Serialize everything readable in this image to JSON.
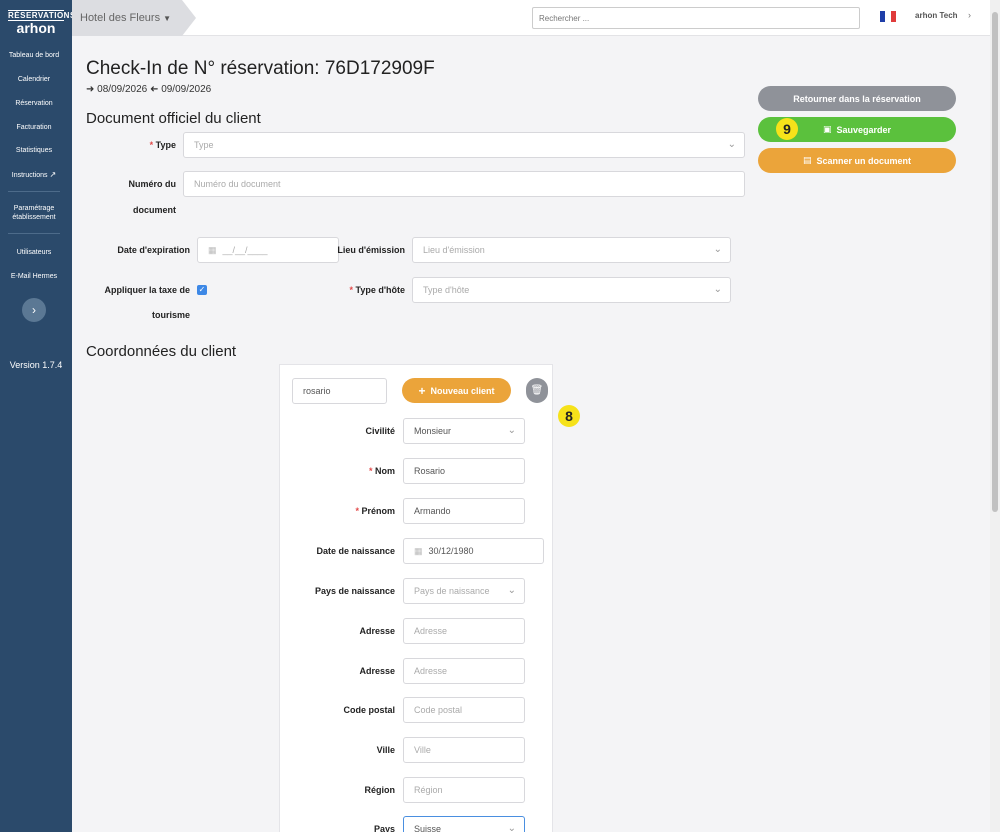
{
  "sidebar": {
    "logo_top": "RÉSERVATIONS",
    "logo_main": "arhon",
    "items": [
      {
        "label": "Tableau de bord"
      },
      {
        "label": "Calendrier"
      },
      {
        "label": "Réservation"
      },
      {
        "label": "Facturation"
      },
      {
        "label": "Statistiques"
      },
      {
        "label": "Instructions"
      },
      {
        "label": "Paramétrage établissement"
      },
      {
        "label": "Utilisateurs"
      },
      {
        "label": "E-Mail Hermes"
      }
    ],
    "expand_icon": "chevron-right-icon",
    "version": "Version 1.7.4"
  },
  "topbar": {
    "hotel": "Hotel des Fleurs",
    "search_placeholder": "Rechercher ...",
    "user": "arhon Tech",
    "flag_colors": [
      "#1f3ea8",
      "#ffffff",
      "#e03b3b"
    ]
  },
  "header": {
    "title": "Check-In de N° réservation: 76D172909F",
    "date_in": "08/09/2026",
    "date_out": "09/09/2026"
  },
  "actions": {
    "back": "Retourner dans la réservation",
    "save": "Sauvegarder",
    "scan": "Scanner un document",
    "badge_save": "9",
    "badge_client": "8"
  },
  "document": {
    "section_title": "Document officiel du client",
    "type_label": "Type",
    "type_placeholder": "Type",
    "number_label_1": "Numéro du",
    "number_label_2": "document",
    "number_placeholder": "Numéro du document",
    "expiry_label": "Date d'expiration",
    "expiry_placeholder": "__/__/____",
    "issue_place_label": "Lieu d'émission",
    "issue_place_placeholder": "Lieu d'émission",
    "tax_label_1": "Appliquer la taxe de",
    "tax_label_2": "tourisme",
    "guest_type_label": "Type d'hôte",
    "guest_type_placeholder": "Type d'hôte"
  },
  "client": {
    "section_title": "Coordonnées du client",
    "search_value": "rosario",
    "new_client": "Nouveau client",
    "fields": {
      "civility": {
        "label": "Civilité",
        "value": "Monsieur"
      },
      "lastname": {
        "label": "Nom",
        "value": "Rosario"
      },
      "firstname": {
        "label": "Prénom",
        "value": "Armando"
      },
      "birthdate": {
        "label": "Date de naissance",
        "value": "30/12/1980"
      },
      "birth_country": {
        "label": "Pays de naissance",
        "placeholder": "Pays de naissance"
      },
      "address1": {
        "label": "Adresse",
        "placeholder": "Adresse"
      },
      "address2": {
        "label": "Adresse",
        "placeholder": "Adresse"
      },
      "postal": {
        "label": "Code postal",
        "placeholder": "Code postal"
      },
      "city": {
        "label": "Ville",
        "placeholder": "Ville"
      },
      "region": {
        "label": "Région",
        "placeholder": "Région"
      },
      "country": {
        "label": "Pays",
        "value": "Suisse"
      }
    }
  }
}
